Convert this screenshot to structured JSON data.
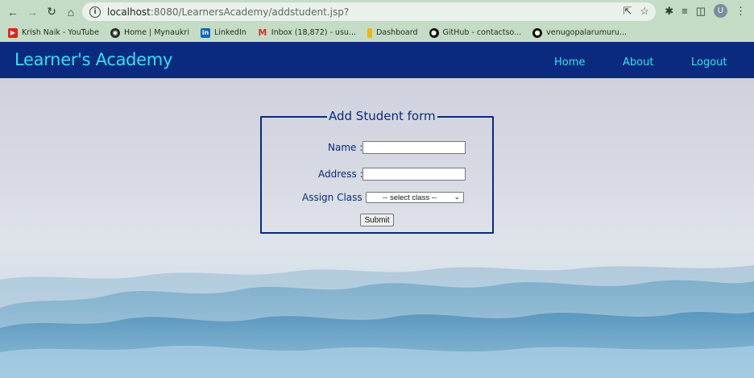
{
  "browser": {
    "url_host": "localhost",
    "url_path": ":8080/LearnersAcademy/addstudent.jsp?",
    "avatar_letter": "U",
    "bookmarks": [
      {
        "label": "Krish Naik - YouTube",
        "icon": "youtube-icon"
      },
      {
        "label": "Home | Mynaukri",
        "icon": "globe-icon"
      },
      {
        "label": "LinkedIn",
        "icon": "linkedin-icon"
      },
      {
        "label": "Inbox (18,872) - usu...",
        "icon": "gmail-icon"
      },
      {
        "label": "Dashboard",
        "icon": "dashboard-icon"
      },
      {
        "label": "GitHub - contactso...",
        "icon": "github-icon"
      },
      {
        "label": "venugopalarumuru...",
        "icon": "github-icon"
      }
    ]
  },
  "app": {
    "brand": "Learner's Academy",
    "nav": {
      "home": "Home",
      "about": "About",
      "logout": "Logout"
    },
    "colors": {
      "header_bg": "#0a2a80",
      "accent": "#34e0f0"
    }
  },
  "form": {
    "legend": "Add Student form",
    "name_label": "Name :",
    "address_label": "Address :",
    "class_label": "Assign Class :",
    "class_selected": "-- select class --",
    "submit_label": "Submit"
  }
}
